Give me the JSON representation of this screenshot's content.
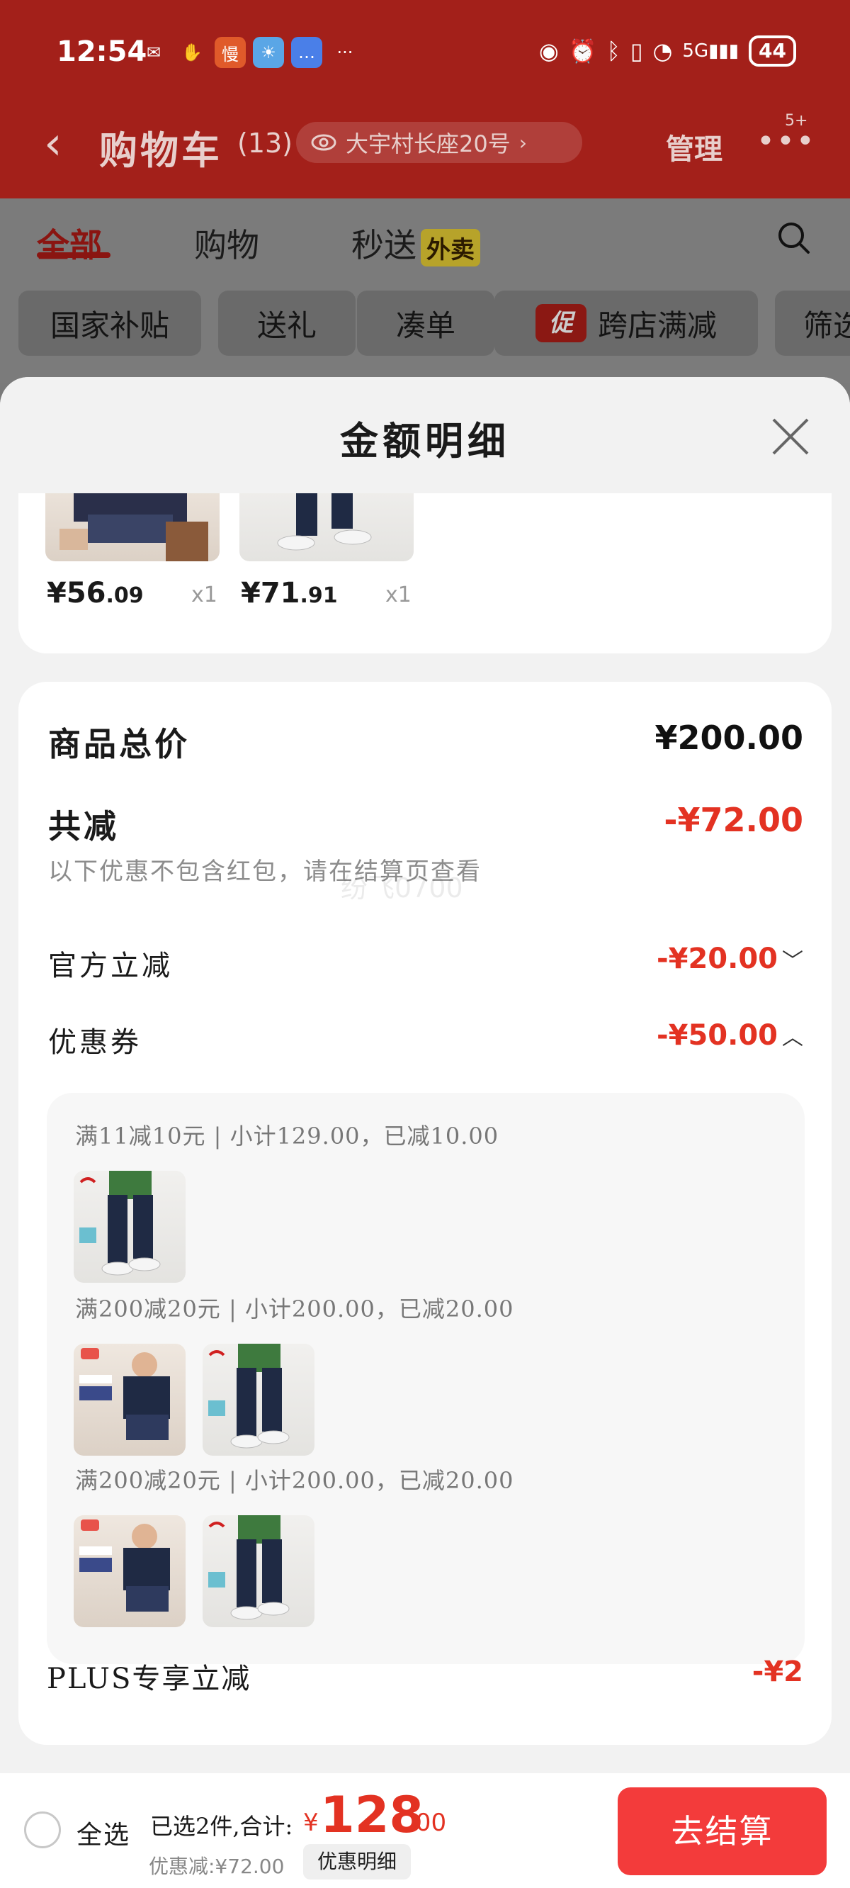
{
  "status_bar": {
    "time": "12:54",
    "right_icons": [
      "eye-icon",
      "alarm-icon",
      "bluetooth-icon",
      "vibrate-icon",
      "wifi-icon",
      "signal-5g-icon"
    ],
    "battery": "44"
  },
  "nav": {
    "title": "购物车",
    "count": "(13)",
    "address": "大宇村长座20号",
    "manage": "管理",
    "more_badge": "5+"
  },
  "tabs": [
    {
      "label": "全部",
      "active": true
    },
    {
      "label": "购物",
      "active": false
    },
    {
      "label": "秒送",
      "active": false
    }
  ],
  "tab_badge": "外卖",
  "chips": [
    "国家补贴",
    "送礼",
    "凑单",
    "跨店满减",
    "筛选"
  ],
  "chip_promo_badge": "促",
  "sheet": {
    "title": "金额明细",
    "items": [
      {
        "price_int": "¥56",
        "price_dec": ".09",
        "qty": "x1"
      },
      {
        "price_int": "¥71",
        "price_dec": ".91",
        "qty": "x1"
      }
    ],
    "total_label": "商品总价",
    "total_value": "¥200.00",
    "reduce_label": "共减",
    "reduce_value": "-¥72.00",
    "reduce_note": "以下优惠不包含红包，请在结算页查看",
    "watermark": "纷飞0700",
    "official_label": "官方立减",
    "official_value": "-¥20.00",
    "coupon_label": "优惠券",
    "coupon_value": "-¥50.00",
    "coupon_groups": [
      {
        "line": "满11减10元 | 小计129.00，已减10.00",
        "products": [
          "pants"
        ]
      },
      {
        "line": "满200减20元 | 小计200.00，已减20.00",
        "products": [
          "shirt",
          "pants"
        ]
      },
      {
        "line": "满200减20元 | 小计200.00，已减20.00",
        "products": [
          "shirt",
          "pants"
        ]
      }
    ],
    "plus_label": "PLUS专享立减",
    "plus_value": "-¥2"
  },
  "bottom": {
    "select_all": "全选",
    "selected_summary": "已选2件,合计:",
    "total_currency": "¥",
    "total_int": "128",
    "total_dec": ".00",
    "discount": "优惠减:¥72.00",
    "detail_button": "优惠明细",
    "checkout": "去结算"
  },
  "colors": {
    "brand_red": "#e33222",
    "checkout_red": "#f33b3b",
    "header_red": "#a3201a"
  }
}
